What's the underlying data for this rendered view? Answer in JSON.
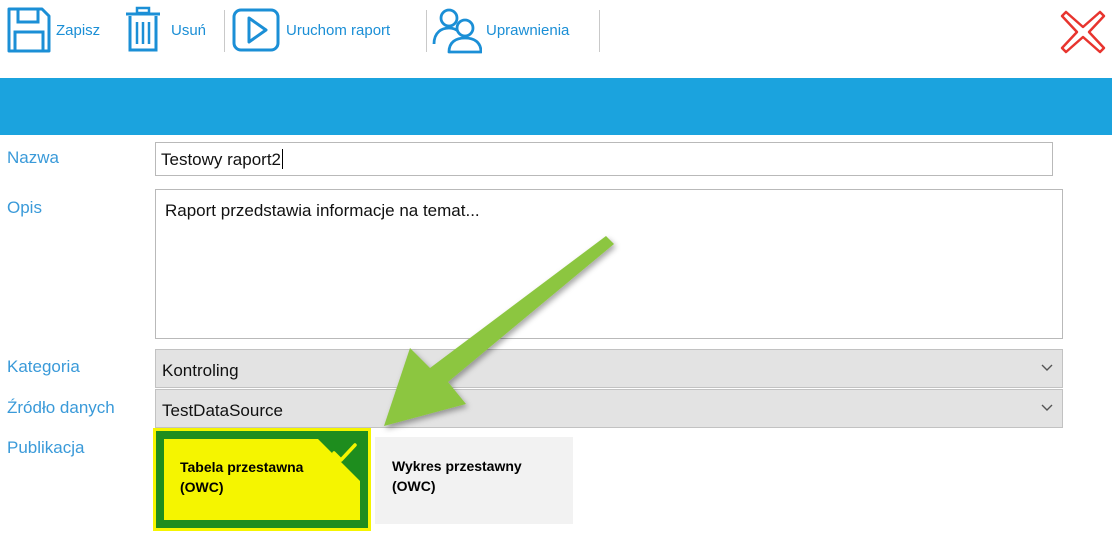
{
  "toolbar": {
    "save_label": "Zapisz",
    "delete_label": "Usuń",
    "run_label": "Uruchom raport",
    "permissions_label": "Uprawnienia"
  },
  "form": {
    "name": {
      "label": "Nazwa",
      "value": "Testowy raport2"
    },
    "description": {
      "label": "Opis",
      "value": "Raport przedstawia informacje na temat..."
    },
    "category": {
      "label": "Kategoria",
      "value": "Kontroling"
    },
    "data_source": {
      "label": "Źródło danych",
      "value": "TestDataSource"
    },
    "publication": {
      "label": "Publikacja",
      "options": [
        {
          "line1": "Tabela przestawna",
          "line2": "(OWC)",
          "selected": true
        },
        {
          "line1": "Wykres przestawny",
          "line2": "(OWC)",
          "selected": false
        }
      ]
    }
  },
  "icons": {
    "save": "floppy-disk-icon",
    "delete": "trash-icon",
    "run": "play-icon",
    "permissions": "users-icon",
    "close": "close-x-icon",
    "dropdown": "chevron-down-icon",
    "selected": "checkmark-icon"
  },
  "colors": {
    "accent": "#1ba3de",
    "label": "#3a9ad9",
    "close": "#e8342e",
    "tile_selected_fill": "#f5f500",
    "tile_selected_border": "#1e8d1e",
    "arrow": "#8cc63f"
  }
}
